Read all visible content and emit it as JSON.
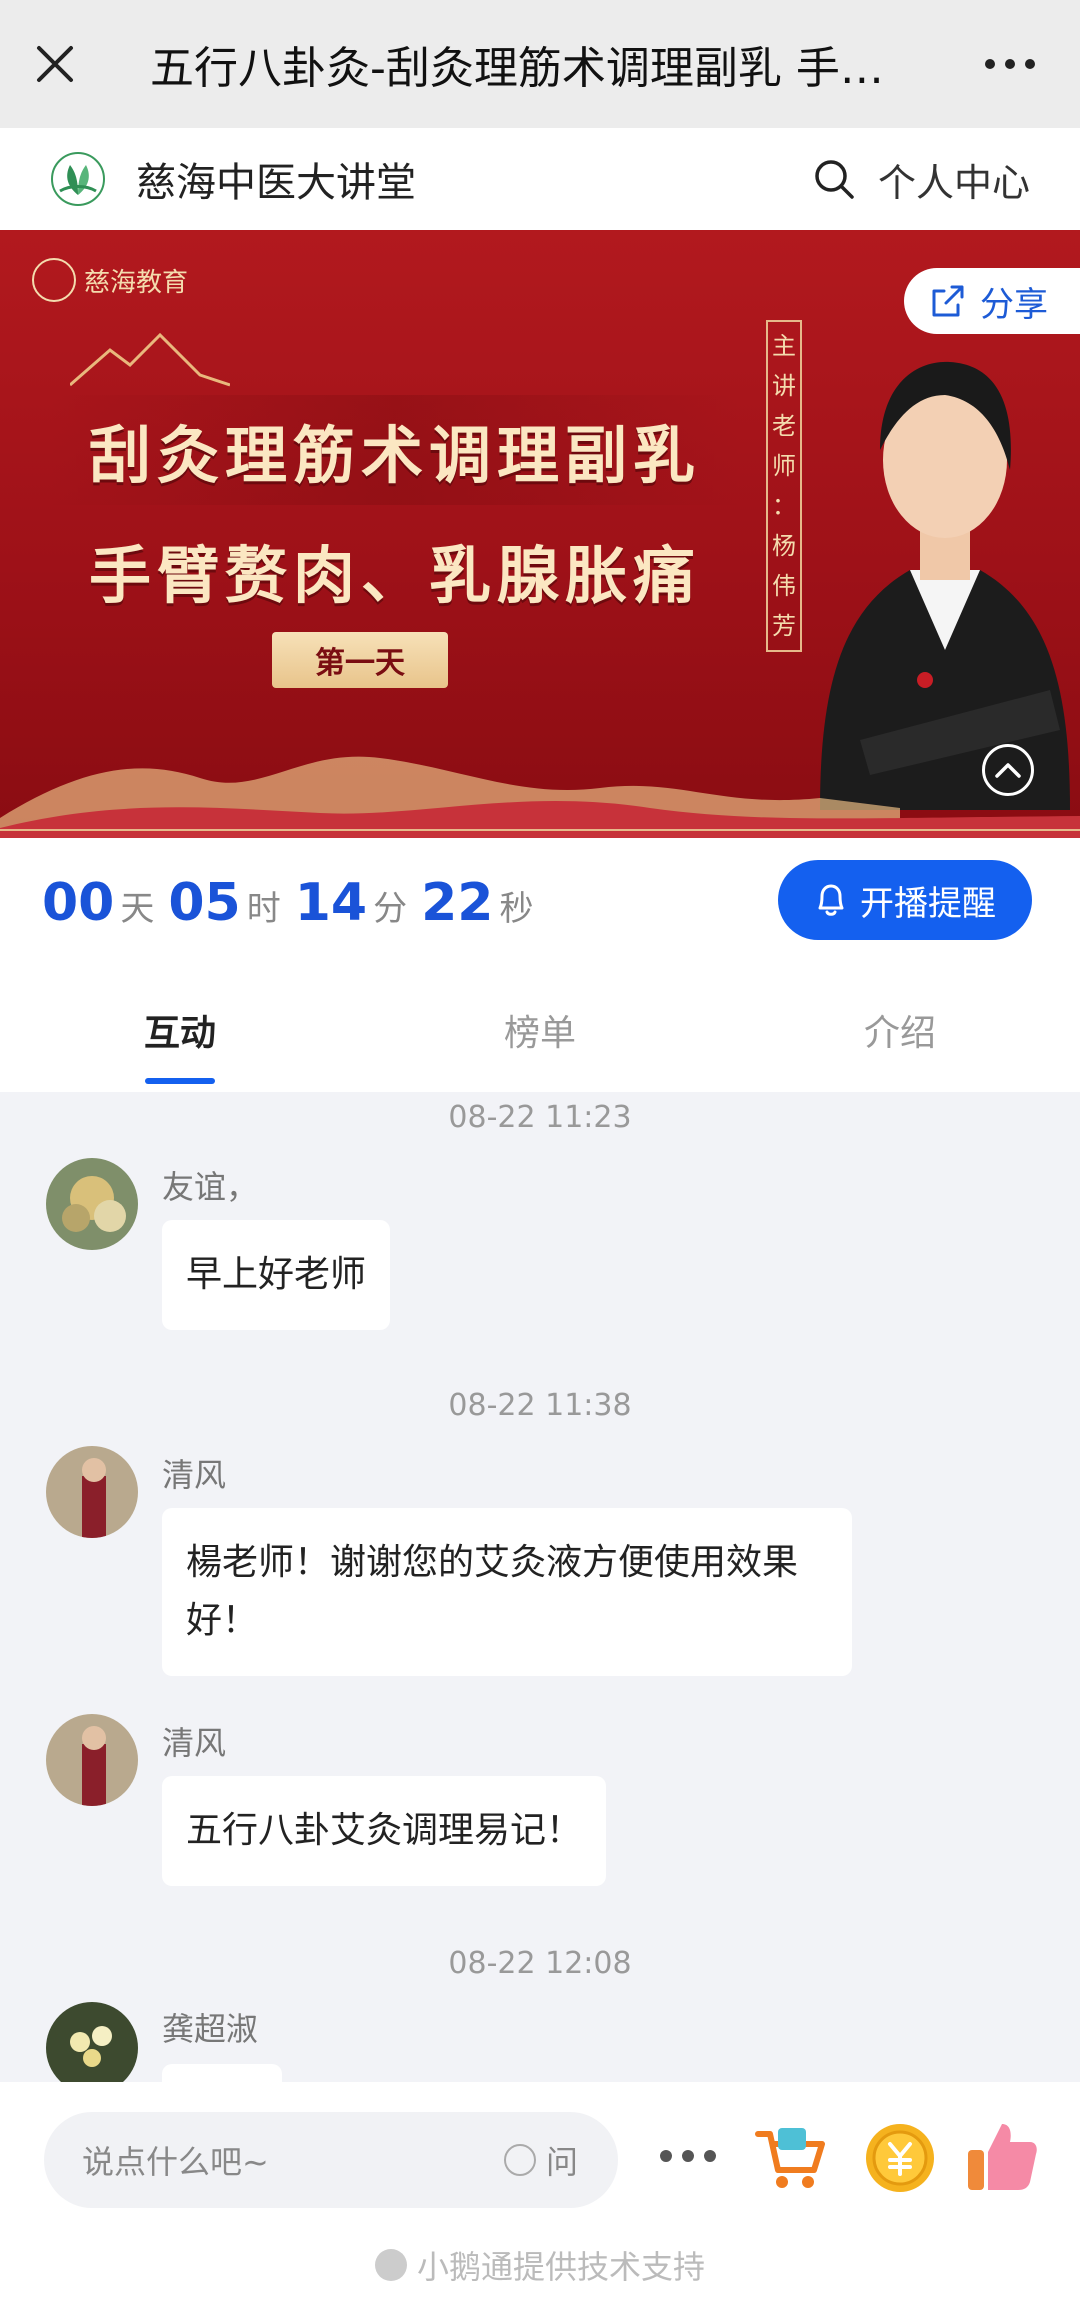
{
  "titlebar": {
    "title": "五行八卦灸-刮灸理筋术调理副乳 手…"
  },
  "brandbar": {
    "brand": "慈海中医大讲堂",
    "personal_center": "个人中心"
  },
  "banner": {
    "org_logo_text": "慈海教育",
    "headline_1": "刮灸理筋术调理副乳",
    "headline_2": "手臂赘肉、乳腺胀痛",
    "day_badge": "第一天",
    "presenter_vertical": [
      "主",
      "讲",
      "老",
      "师",
      "：",
      "杨",
      "伟",
      "芳"
    ],
    "share_label": "分享"
  },
  "countdown": {
    "days": "00",
    "days_unit": "天",
    "hours": "05",
    "hours_unit": "时",
    "minutes": "14",
    "minutes_unit": "分",
    "seconds": "22",
    "seconds_unit": "秒",
    "remind_label": "开播提醒"
  },
  "tabs": [
    {
      "label": "互动",
      "active": true
    },
    {
      "label": "榜单",
      "active": false
    },
    {
      "label": "介绍",
      "active": false
    }
  ],
  "chat": {
    "timestamps": [
      "08-22 11:23",
      "08-22 11:38",
      "08-22 12:08"
    ],
    "messages": [
      {
        "user": "友谊，",
        "text": "早上好老师"
      },
      {
        "user": "清风",
        "text": "楊老师！谢谢您的艾灸液方便使用效果好！"
      },
      {
        "user": "清风",
        "text": "五行八卦艾灸调理易记！"
      },
      {
        "user": "龚超淑",
        "text": ""
      }
    ]
  },
  "bottombar": {
    "input_placeholder": "说点什么吧~",
    "ask_label": "问",
    "footer": "小鹅通提供技术支持"
  },
  "colors": {
    "accent": "#1460ef",
    "countdown_number": "#1a53d8",
    "banner_red": "#a3141a"
  }
}
